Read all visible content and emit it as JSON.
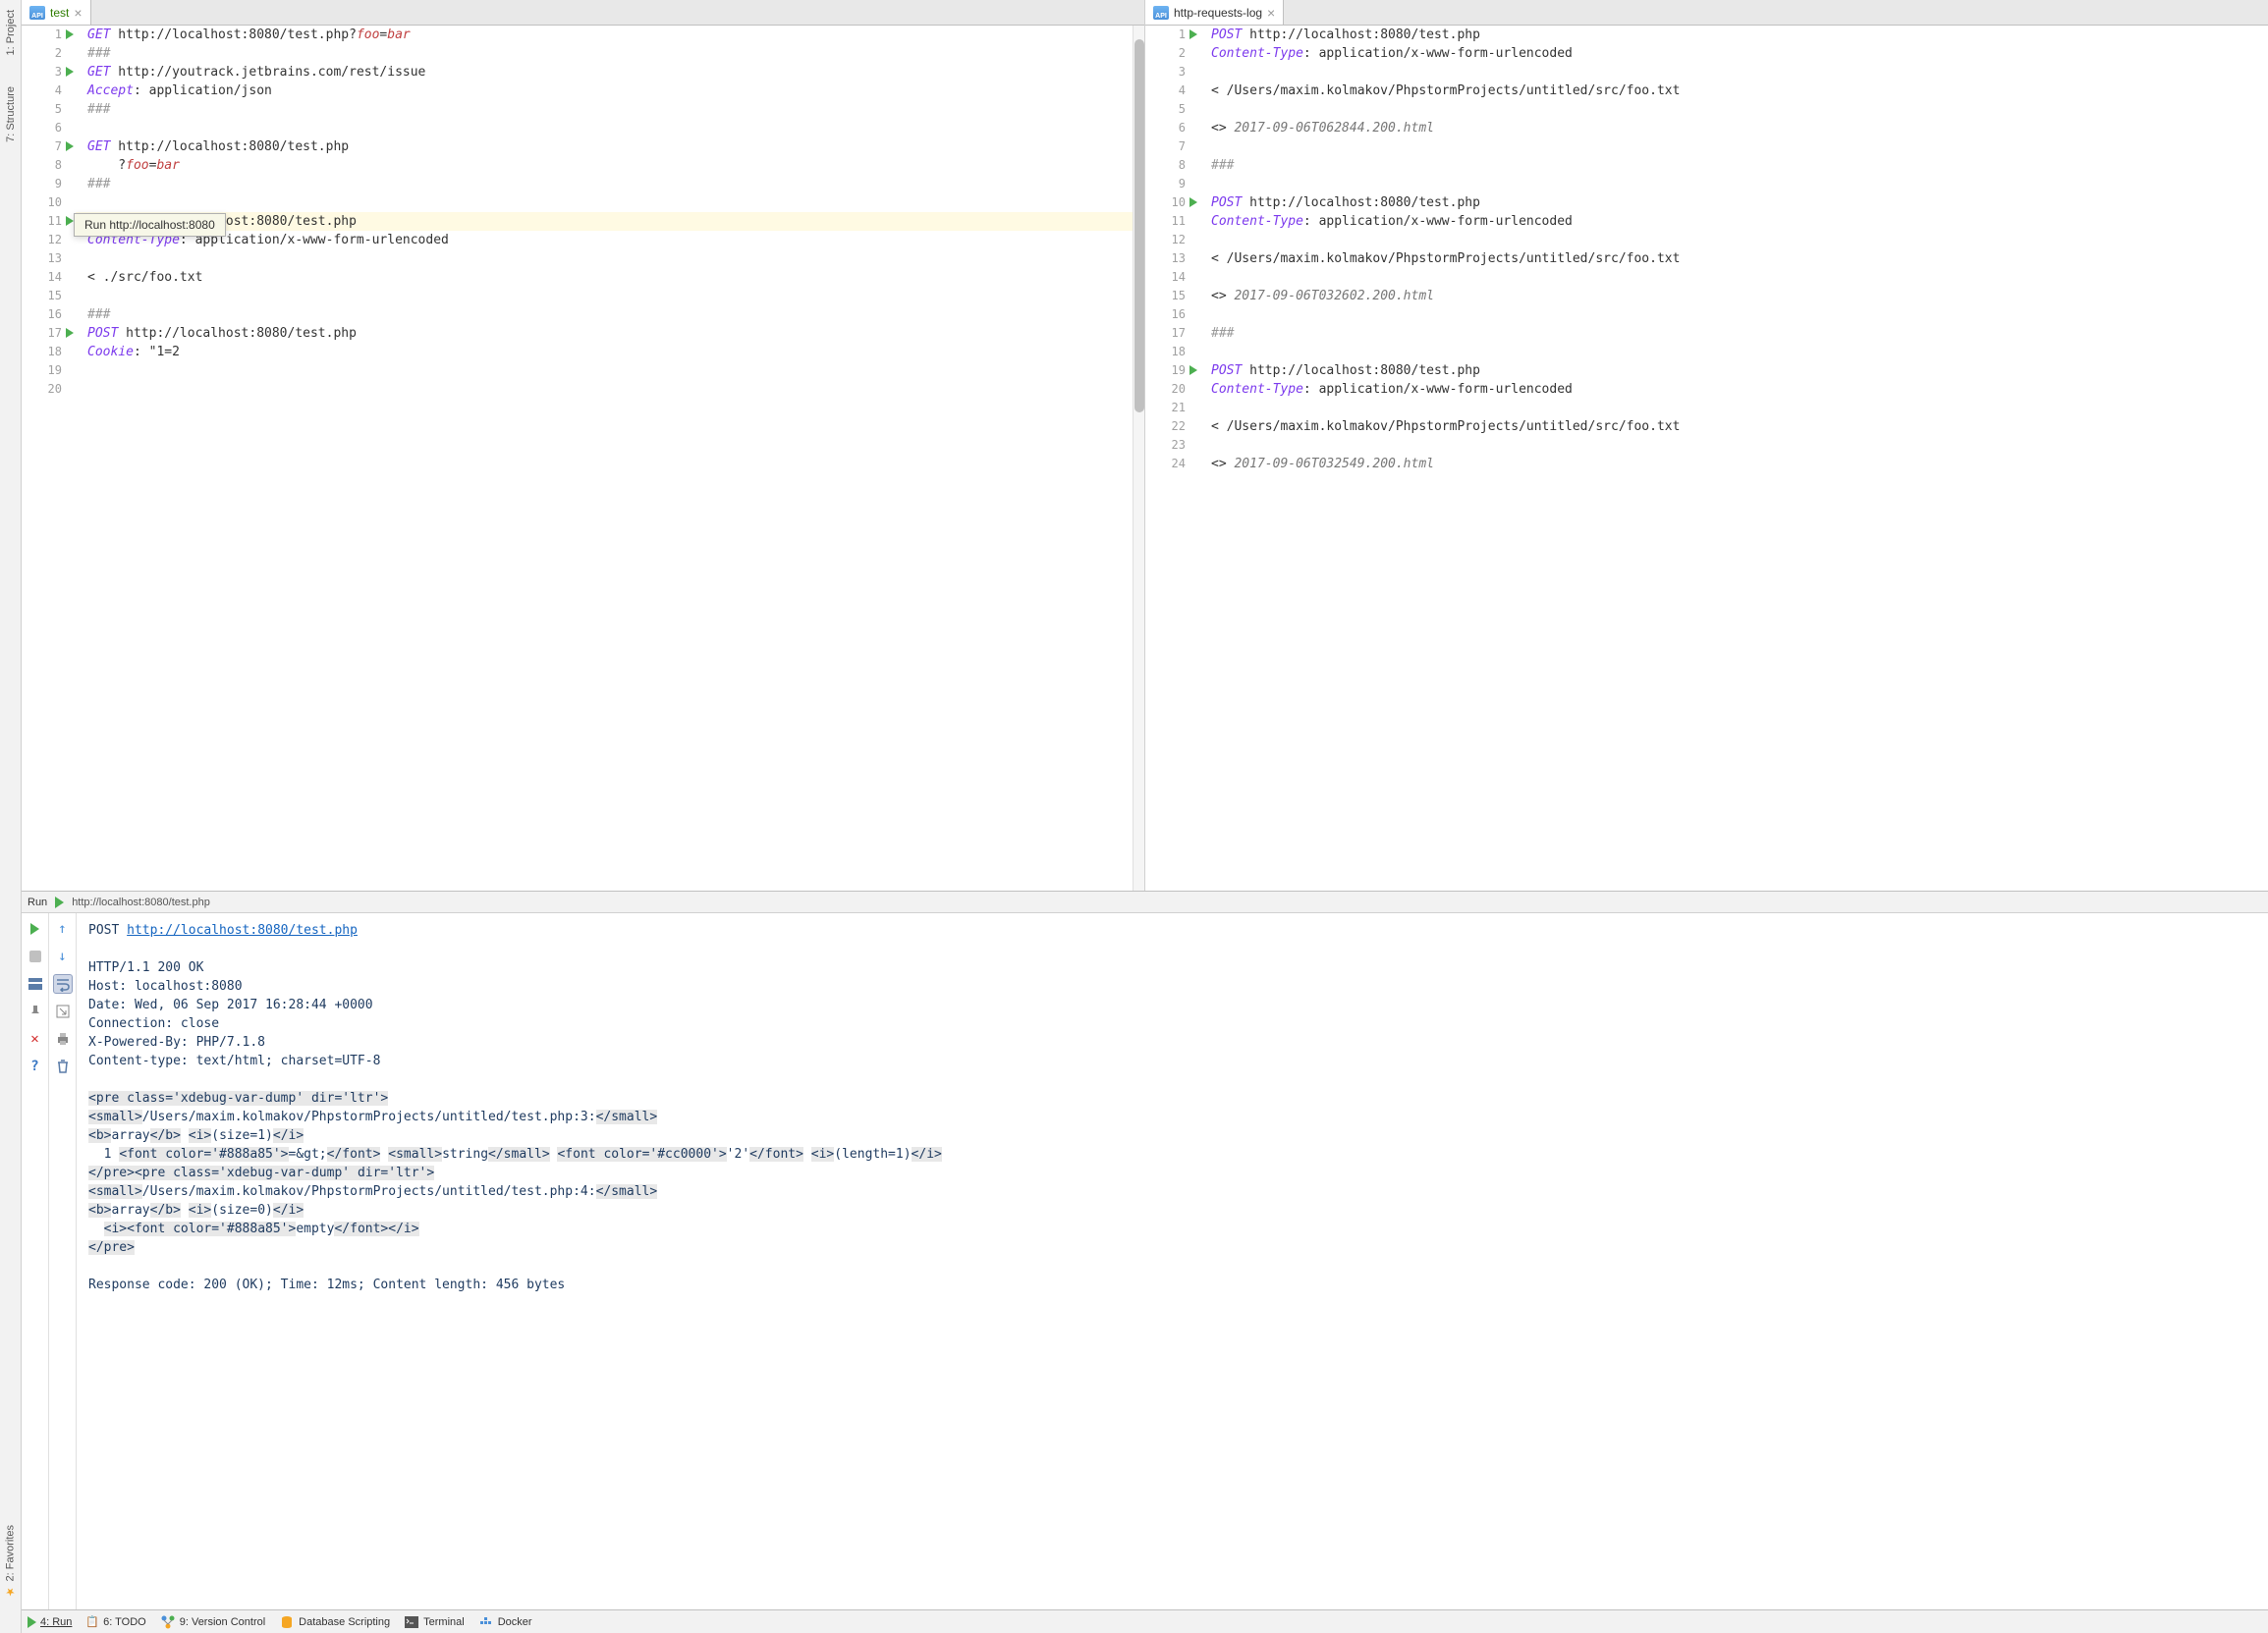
{
  "left_sidebar": {
    "project": "1: Project",
    "structure": "7: Structure",
    "favorites": "2: Favorites"
  },
  "left_tab": {
    "name": "test",
    "lines": [
      {
        "n": 1,
        "run": true,
        "spans": [
          {
            "c": "kw-method",
            "t": "GET"
          },
          {
            "c": "",
            "t": " http://localhost:8080/test.php?"
          },
          {
            "c": "kw-param",
            "t": "foo"
          },
          {
            "c": "",
            "t": "="
          },
          {
            "c": "kw-param",
            "t": "bar"
          }
        ]
      },
      {
        "n": 2,
        "spans": [
          {
            "c": "kw-delim",
            "t": "###"
          }
        ]
      },
      {
        "n": 3,
        "run": true,
        "spans": [
          {
            "c": "kw-method",
            "t": "GET"
          },
          {
            "c": "",
            "t": " http://youtrack.jetbrains.com/rest/issue"
          }
        ]
      },
      {
        "n": 4,
        "spans": [
          {
            "c": "kw-header",
            "t": "Accept"
          },
          {
            "c": "",
            "t": ": application/json"
          }
        ]
      },
      {
        "n": 5,
        "spans": [
          {
            "c": "kw-delim",
            "t": "###"
          }
        ]
      },
      {
        "n": 6,
        "spans": []
      },
      {
        "n": 7,
        "run": true,
        "spans": [
          {
            "c": "kw-method",
            "t": "GET"
          },
          {
            "c": "",
            "t": " http://localhost:8080/test.php"
          }
        ]
      },
      {
        "n": 8,
        "spans": [
          {
            "c": "",
            "t": "    ?"
          },
          {
            "c": "kw-param",
            "t": "foo"
          },
          {
            "c": "",
            "t": "="
          },
          {
            "c": "kw-param",
            "t": "bar"
          }
        ]
      },
      {
        "n": 9,
        "spans": [
          {
            "c": "kw-delim",
            "t": "###"
          }
        ]
      },
      {
        "n": 10,
        "spans": []
      },
      {
        "n": 11,
        "run": true,
        "highlight": true,
        "spans": [
          {
            "c": "kw-method",
            "t": "POST"
          },
          {
            "c": "",
            "t": " http://localhost:8080/test.php"
          }
        ]
      },
      {
        "n": 12,
        "spans": [
          {
            "c": "kw-header",
            "t": "Content-Type"
          },
          {
            "c": "",
            "t": ": application/x-www-form-urlencoded"
          }
        ]
      },
      {
        "n": 13,
        "spans": []
      },
      {
        "n": 14,
        "spans": [
          {
            "c": "",
            "t": "< ./src/foo.txt"
          }
        ]
      },
      {
        "n": 15,
        "spans": []
      },
      {
        "n": 16,
        "spans": [
          {
            "c": "kw-delim",
            "t": "###"
          }
        ]
      },
      {
        "n": 17,
        "run": true,
        "spans": [
          {
            "c": "kw-method",
            "t": "POST"
          },
          {
            "c": "",
            "t": " http://localhost:8080/test.php"
          }
        ]
      },
      {
        "n": 18,
        "spans": [
          {
            "c": "kw-header",
            "t": "Cookie"
          },
          {
            "c": "",
            "t": ": \"1=2"
          }
        ]
      },
      {
        "n": 19,
        "spans": []
      },
      {
        "n": 20,
        "spans": []
      }
    ]
  },
  "right_tab": {
    "name": "http-requests-log",
    "lines": [
      {
        "n": 1,
        "run": true,
        "spans": [
          {
            "c": "kw-method",
            "t": "POST"
          },
          {
            "c": "",
            "t": " http://localhost:8080/test.php"
          }
        ]
      },
      {
        "n": 2,
        "spans": [
          {
            "c": "kw-header",
            "t": "Content-Type"
          },
          {
            "c": "",
            "t": ": application/x-www-form-urlencoded"
          }
        ]
      },
      {
        "n": 3,
        "spans": []
      },
      {
        "n": 4,
        "spans": [
          {
            "c": "",
            "t": "< /Users/maxim.kolmakov/PhpstormProjects/untitled/src/foo.txt"
          }
        ]
      },
      {
        "n": 5,
        "spans": []
      },
      {
        "n": 6,
        "spans": [
          {
            "c": "",
            "t": "<> "
          },
          {
            "c": "kw-gray",
            "t": "2017-09-06T062844.200.html"
          }
        ]
      },
      {
        "n": 7,
        "spans": []
      },
      {
        "n": 8,
        "spans": [
          {
            "c": "kw-delim",
            "t": "###"
          }
        ]
      },
      {
        "n": 9,
        "spans": []
      },
      {
        "n": 10,
        "run": true,
        "spans": [
          {
            "c": "kw-method",
            "t": "POST"
          },
          {
            "c": "",
            "t": " http://localhost:8080/test.php"
          }
        ]
      },
      {
        "n": 11,
        "spans": [
          {
            "c": "kw-header",
            "t": "Content-Type"
          },
          {
            "c": "",
            "t": ": application/x-www-form-urlencoded"
          }
        ]
      },
      {
        "n": 12,
        "spans": []
      },
      {
        "n": 13,
        "spans": [
          {
            "c": "",
            "t": "< /Users/maxim.kolmakov/PhpstormProjects/untitled/src/foo.txt"
          }
        ]
      },
      {
        "n": 14,
        "spans": []
      },
      {
        "n": 15,
        "spans": [
          {
            "c": "",
            "t": "<> "
          },
          {
            "c": "kw-gray",
            "t": "2017-09-06T032602.200.html"
          }
        ]
      },
      {
        "n": 16,
        "spans": []
      },
      {
        "n": 17,
        "spans": [
          {
            "c": "kw-delim",
            "t": "###"
          }
        ]
      },
      {
        "n": 18,
        "spans": []
      },
      {
        "n": 19,
        "run": true,
        "spans": [
          {
            "c": "kw-method",
            "t": "POST"
          },
          {
            "c": "",
            "t": " http://localhost:8080/test.php"
          }
        ]
      },
      {
        "n": 20,
        "spans": [
          {
            "c": "kw-header",
            "t": "Content-Type"
          },
          {
            "c": "",
            "t": ": application/x-www-form-urlencoded"
          }
        ]
      },
      {
        "n": 21,
        "spans": []
      },
      {
        "n": 22,
        "spans": [
          {
            "c": "",
            "t": "< /Users/maxim.kolmakov/PhpstormProjects/untitled/src/foo.txt"
          }
        ]
      },
      {
        "n": 23,
        "spans": []
      },
      {
        "n": 24,
        "spans": [
          {
            "c": "",
            "t": "<> "
          },
          {
            "c": "kw-gray",
            "t": "2017-09-06T032549.200.html"
          }
        ]
      }
    ]
  },
  "tooltip": "Run http://localhost:8080",
  "run_panel": {
    "title": "Run",
    "subtitle": "http://localhost:8080/test.php",
    "output": {
      "pre": [
        "POST ",
        "http://localhost:8080/test.php"
      ],
      "headers": [
        "HTTP/1.1 200 OK",
        "Host: localhost:8080",
        "Date: Wed, 06 Sep 2017 16:28:44 +0000",
        "Connection: close",
        "X-Powered-By: PHP/7.1.8",
        "Content-type: text/html; charset=UTF-8"
      ],
      "body": [
        [
          {
            "tag": true,
            "t": "<pre class='xdebug-var-dump' dir='ltr'>"
          }
        ],
        [
          {
            "tag": true,
            "t": "<small>"
          },
          {
            "t": "/Users/maxim.kolmakov/PhpstormProjects/untitled/test.php:3:"
          },
          {
            "tag": true,
            "t": "</small>"
          }
        ],
        [
          {
            "tag": true,
            "t": "<b>"
          },
          {
            "t": "array"
          },
          {
            "tag": true,
            "t": "</b>"
          },
          {
            "t": " "
          },
          {
            "tag": true,
            "t": "<i>"
          },
          {
            "t": "(size=1)"
          },
          {
            "tag": true,
            "t": "</i>"
          }
        ],
        [
          {
            "t": "  1 "
          },
          {
            "tag": true,
            "t": "<font color='#888a85'>"
          },
          {
            "t": "=&gt;"
          },
          {
            "tag": true,
            "t": "</font>"
          },
          {
            "t": " "
          },
          {
            "tag": true,
            "t": "<small>"
          },
          {
            "t": "string"
          },
          {
            "tag": true,
            "t": "</small>"
          },
          {
            "t": " "
          },
          {
            "tag": true,
            "t": "<font color='#cc0000'>"
          },
          {
            "t": "'2'"
          },
          {
            "tag": true,
            "t": "</font>"
          },
          {
            "t": " "
          },
          {
            "tag": true,
            "t": "<i>"
          },
          {
            "t": "(length=1)"
          },
          {
            "tag": true,
            "t": "</i>"
          }
        ],
        [
          {
            "tag": true,
            "t": "</pre>"
          },
          {
            "tag": true,
            "t": "<pre class='xdebug-var-dump' dir='ltr'>"
          }
        ],
        [
          {
            "tag": true,
            "t": "<small>"
          },
          {
            "t": "/Users/maxim.kolmakov/PhpstormProjects/untitled/test.php:4:"
          },
          {
            "tag": true,
            "t": "</small>"
          }
        ],
        [
          {
            "tag": true,
            "t": "<b>"
          },
          {
            "t": "array"
          },
          {
            "tag": true,
            "t": "</b>"
          },
          {
            "t": " "
          },
          {
            "tag": true,
            "t": "<i>"
          },
          {
            "t": "(size=0)"
          },
          {
            "tag": true,
            "t": "</i>"
          }
        ],
        [
          {
            "t": "  "
          },
          {
            "tag": true,
            "t": "<i>"
          },
          {
            "tag": true,
            "t": "<font color='#888a85'>"
          },
          {
            "t": "empty"
          },
          {
            "tag": true,
            "t": "</font>"
          },
          {
            "tag": true,
            "t": "</i>"
          }
        ],
        [
          {
            "tag": true,
            "t": "</pre>"
          }
        ]
      ],
      "footer": "Response code: 200 (OK); Time: 12ms; Content length: 456 bytes"
    }
  },
  "bottom_bar": {
    "run": "4: Run",
    "todo": "6: TODO",
    "vcs": "9: Version Control",
    "db": "Database Scripting",
    "terminal": "Terminal",
    "docker": "Docker"
  }
}
